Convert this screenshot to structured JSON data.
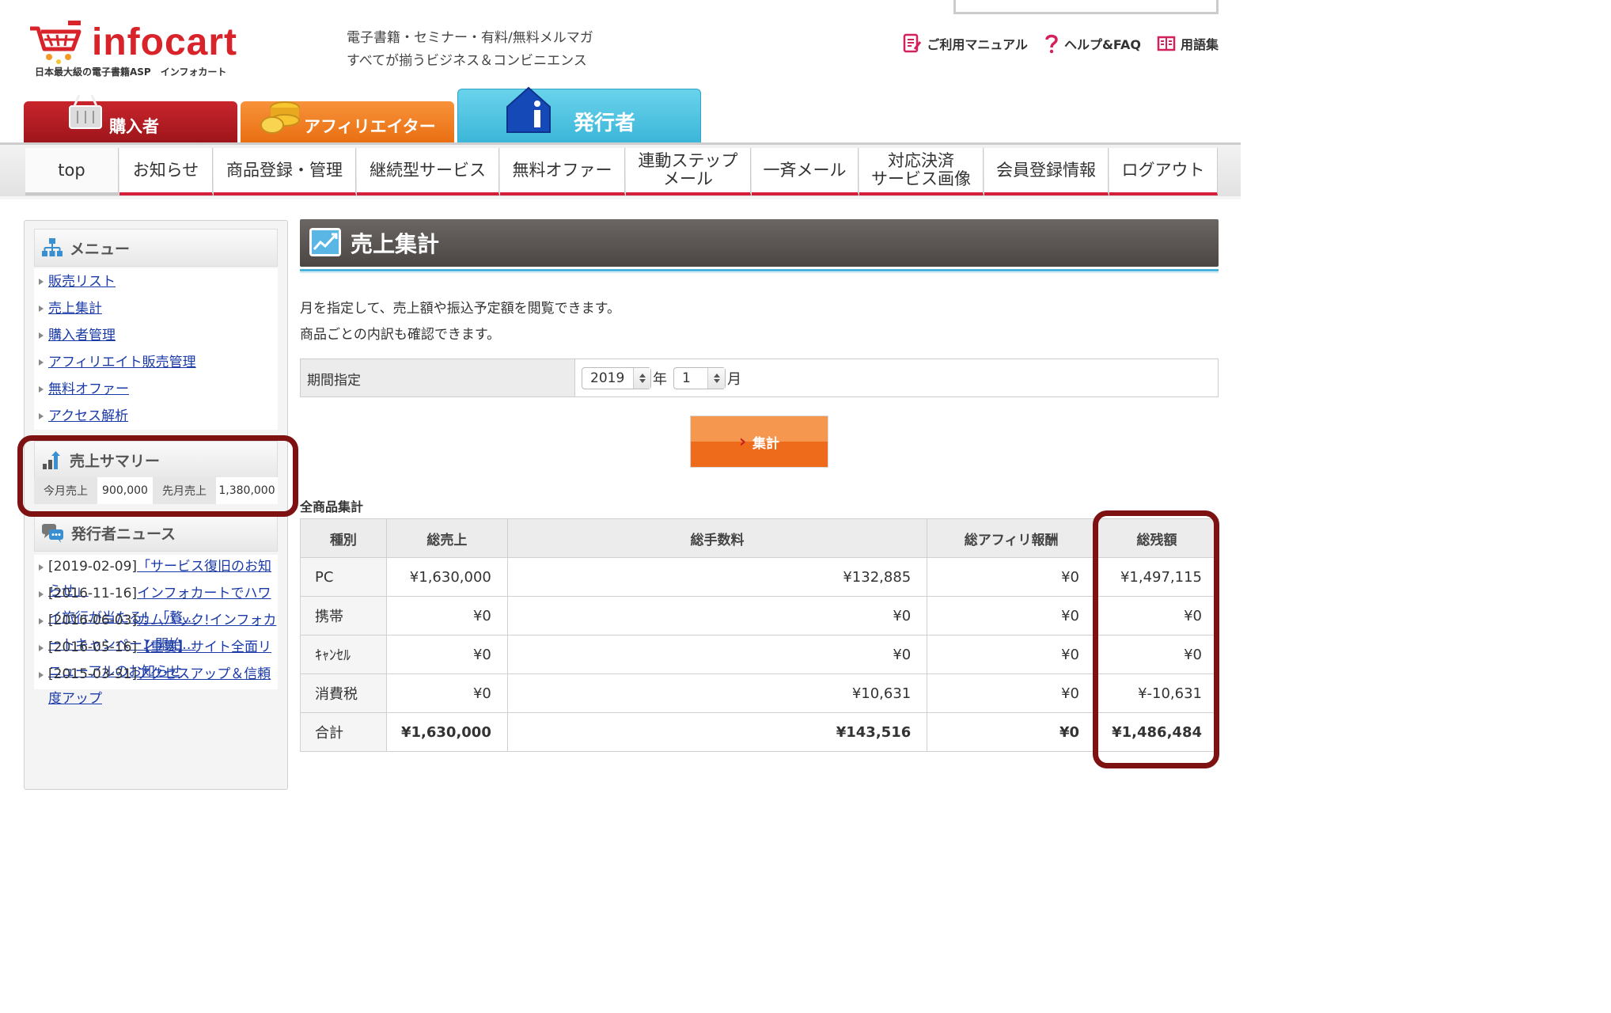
{
  "brand": {
    "logo_text": "infocart",
    "logo_sub": "日本最大級の電子書籍ASP　インフォカート",
    "tagline_line1": "電子書籍・セミナー・有料/無料メルマガ",
    "tagline_line2": "すべてが揃うビジネス＆コンビニエンス"
  },
  "top_links": [
    {
      "label": "ご利用マニュアル",
      "icon": "manual-icon"
    },
    {
      "label": "ヘルプ&FAQ",
      "icon": "question-icon"
    },
    {
      "label": "用語集",
      "icon": "book-icon"
    }
  ],
  "role_tabs": {
    "buyer": "購入者",
    "affiliate": "アフィリエイター",
    "publisher": "発行者"
  },
  "nav": [
    "top",
    "お知らせ",
    "商品登録・管理",
    "継続型サービス",
    "無料オファー",
    "連動ステップ\nメール",
    "一斉メール",
    "対応決済\nサービス画像",
    "会員登録情報",
    "ログアウト"
  ],
  "sidebar": {
    "menu_title": "メニュー",
    "menu_items": [
      "販売リスト",
      "売上集計",
      "購入者管理",
      "アフィリエイト販売管理",
      "無料オファー",
      "アクセス解析"
    ],
    "summary_title": "売上サマリー",
    "summary": {
      "this_month_label": "今月売上",
      "this_month_value": "900,000",
      "last_month_label": "先月売上",
      "last_month_value": "1,380,000"
    },
    "news_title": "発行者ニュース",
    "news": [
      {
        "date": "[2019-02-09]",
        "title": "「サービス復旧のお知らせ」"
      },
      {
        "date": "[2016-11-16]",
        "title": "インフォカートでハワイ旅行が当たる！「贅…"
      },
      {
        "date": "[2016-06-03]",
        "title": "カムバック!インフォカートキャンペーン開始…"
      },
      {
        "date": "[2016-05-16]",
        "title": "【重要】サイト全面リニューアルのお知らせ"
      },
      {
        "date": "[2015-03-31]",
        "title": "アクセスアップ＆信頼度アップ"
      }
    ]
  },
  "main": {
    "title": "売上集計",
    "desc_line1": "月を指定して、売上額や振込予定額を閲覧できます。",
    "desc_line2": "商品ごとの内訳も確認できます。",
    "period_label": "期間指定",
    "year_value": "2019",
    "year_suffix": "年",
    "month_value": "1",
    "month_suffix": "月",
    "submit_label": "集計",
    "table_caption": "全商品集計",
    "table": {
      "headers": [
        "種別",
        "総売上",
        "総手数料",
        "総アフィリ報酬",
        "総残額"
      ],
      "rows": [
        [
          "PC",
          "¥1,630,000",
          "¥132,885",
          "¥0",
          "¥1,497,115"
        ],
        [
          "携帯",
          "¥0",
          "¥0",
          "¥0",
          "¥0"
        ],
        [
          "ｷｬﾝｾﾙ",
          "¥0",
          "¥0",
          "¥0",
          "¥0"
        ],
        [
          "消費税",
          "¥0",
          "¥10,631",
          "¥0",
          "¥-10,631"
        ],
        [
          "合計",
          "¥1,630,000",
          "¥143,516",
          "¥0",
          "¥1,486,484"
        ]
      ]
    }
  },
  "colors": {
    "brand_red": "#d9232a",
    "nav_underline": "#d51f3a",
    "highlight": "#7e1212",
    "accent_blue": "#45b3de",
    "button_orange": "#ef6b1c"
  }
}
